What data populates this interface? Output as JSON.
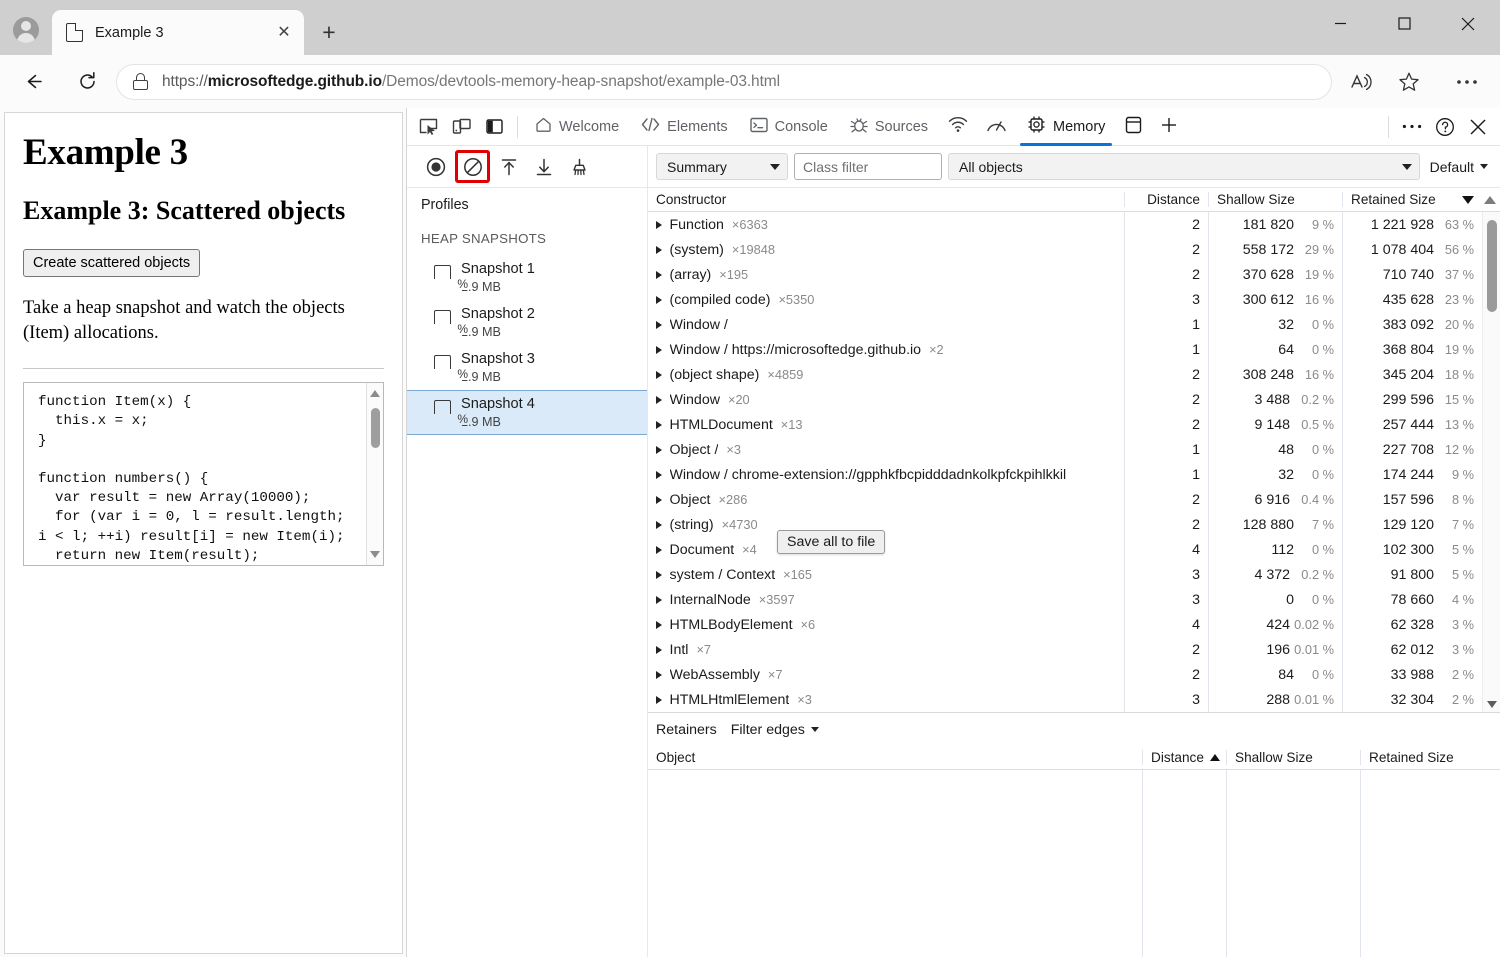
{
  "browser": {
    "tab": {
      "title": "Example 3",
      "close_label": "✕"
    },
    "new_tab_label": "+",
    "window_controls": {
      "minimize": "minimize-icon",
      "maximize": "maximize-icon",
      "close": "close-icon"
    },
    "toolbar": {
      "back_label": "back-arrow-icon",
      "reload_label": "reload-icon",
      "url_protocol": "https://",
      "url_host": "microsoftedge.github.io",
      "url_path": "/Demos/devtools-memory-heap-snapshot/example-03.html",
      "read_aloud_label": "read-aloud-icon",
      "favorite_label": "star-icon",
      "settings_label": "ellipsis-icon"
    }
  },
  "page": {
    "h1": "Example 3",
    "h2": "Example 3: Scattered objects",
    "button": "Create scattered objects",
    "paragraph": "Take a heap snapshot and watch the objects (Item) allocations.",
    "code": "function Item(x) {\n  this.x = x;\n}\n\nfunction numbers() {\n  var result = new Array(10000);\n  for (var i = 0, l = result.length;\ni < l; ++i) result[i] = new Item(i);\n  return new Item(result);"
  },
  "devtools": {
    "left_icons": [
      "inspect-icon",
      "device-toolbar-icon",
      "dock-side-icon"
    ],
    "tabs": [
      {
        "label": "Welcome",
        "icon": "home-icon",
        "active": false
      },
      {
        "label": "Elements",
        "icon": "code-brackets-icon",
        "active": false
      },
      {
        "label": "Console",
        "icon": "console-icon",
        "active": false
      },
      {
        "label": "Sources",
        "icon": "bug-icon",
        "active": false
      },
      {
        "label": "",
        "icon": "network-icon",
        "active": false
      },
      {
        "label": "",
        "icon": "performance-icon",
        "active": false
      },
      {
        "label": "Memory",
        "icon": "memory-chip-icon",
        "active": true
      },
      {
        "label": "",
        "icon": "application-icon",
        "active": false
      },
      {
        "label": "",
        "icon": "plus-icon",
        "active": false
      }
    ],
    "right_icons": [
      "ellipsis-icon",
      "help-icon",
      "close-icon"
    ],
    "accent_color": "#0a73d6",
    "highlight_color": "#e00000"
  },
  "memory": {
    "toolbar_buttons": [
      {
        "name": "record-heap-snapshot",
        "icon": "record-circle-icon",
        "highlighted": false
      },
      {
        "name": "clear-all-profiles",
        "icon": "clear-prohibited-icon",
        "highlighted": true
      },
      {
        "name": "load-profile",
        "icon": "arrow-up-to-bar-icon",
        "highlighted": false
      },
      {
        "name": "save-profile",
        "icon": "arrow-down-to-bar-icon",
        "highlighted": false
      },
      {
        "name": "collect-garbage",
        "icon": "broom-icon",
        "highlighted": false
      }
    ],
    "view_select": "Summary",
    "class_filter_placeholder": "Class filter",
    "class_filter_value": "",
    "objects_select": "All objects",
    "default_label": "Default",
    "tooltip_button": "Save all to file"
  },
  "profiles": {
    "title": "Profiles",
    "group_label": "HEAP SNAPSHOTS",
    "snapshots": [
      {
        "name": "Snapshot 1",
        "size": "1.9 MB",
        "selected": false
      },
      {
        "name": "Snapshot 2",
        "size": "1.9 MB",
        "selected": false
      },
      {
        "name": "Snapshot 3",
        "size": "1.9 MB",
        "selected": false
      },
      {
        "name": "Snapshot 4",
        "size": "1.9 MB",
        "selected": true
      }
    ]
  },
  "constructor_table": {
    "columns": [
      "Constructor",
      "Distance",
      "Shallow Size",
      "Retained Size"
    ],
    "sorted_by": "Retained Size",
    "sort_dir": "desc",
    "rows": [
      {
        "constructor": "Function",
        "count": "×6363",
        "distance": "2",
        "shallow": "181 820",
        "shallow_pct": "9 %",
        "retained": "1 221 928",
        "retained_pct": "63 %"
      },
      {
        "constructor": "(system)",
        "count": "×19848",
        "distance": "2",
        "shallow": "558 172",
        "shallow_pct": "29 %",
        "retained": "1 078 404",
        "retained_pct": "56 %"
      },
      {
        "constructor": "(array)",
        "count": "×195",
        "distance": "2",
        "shallow": "370 628",
        "shallow_pct": "19 %",
        "retained": "710 740",
        "retained_pct": "37 %"
      },
      {
        "constructor": "(compiled code)",
        "count": "×5350",
        "distance": "3",
        "shallow": "300 612",
        "shallow_pct": "16 %",
        "retained": "435 628",
        "retained_pct": "23 %"
      },
      {
        "constructor": "Window /",
        "count": "",
        "distance": "1",
        "shallow": "32",
        "shallow_pct": "0 %",
        "retained": "383 092",
        "retained_pct": "20 %"
      },
      {
        "constructor": "Window / https://microsoftedge.github.io",
        "count": "×2",
        "distance": "1",
        "shallow": "64",
        "shallow_pct": "0 %",
        "retained": "368 804",
        "retained_pct": "19 %"
      },
      {
        "constructor": "(object shape)",
        "count": "×4859",
        "distance": "2",
        "shallow": "308 248",
        "shallow_pct": "16 %",
        "retained": "345 204",
        "retained_pct": "18 %"
      },
      {
        "constructor": "Window",
        "count": "×20",
        "distance": "2",
        "shallow": "3 488",
        "shallow_pct": "0.2 %",
        "retained": "299 596",
        "retained_pct": "15 %"
      },
      {
        "constructor": "HTMLDocument",
        "count": "×13",
        "distance": "2",
        "shallow": "9 148",
        "shallow_pct": "0.5 %",
        "retained": "257 444",
        "retained_pct": "13 %"
      },
      {
        "constructor": "Object /",
        "count": "×3",
        "distance": "1",
        "shallow": "48",
        "shallow_pct": "0 %",
        "retained": "227 708",
        "retained_pct": "12 %"
      },
      {
        "constructor": "Window / chrome-extension://gpphkfbcpidddadnkolkpfckpihlkkil",
        "count": "",
        "distance": "1",
        "shallow": "32",
        "shallow_pct": "0 %",
        "retained": "174 244",
        "retained_pct": "9 %"
      },
      {
        "constructor": "Object",
        "count": "×286",
        "distance": "2",
        "shallow": "6 916",
        "shallow_pct": "0.4 %",
        "retained": "157 596",
        "retained_pct": "8 %"
      },
      {
        "constructor": "(string)",
        "count": "×4730",
        "distance": "2",
        "shallow": "128 880",
        "shallow_pct": "7 %",
        "retained": "129 120",
        "retained_pct": "7 %"
      },
      {
        "constructor": "Document",
        "count": "×4",
        "distance": "4",
        "shallow": "112",
        "shallow_pct": "0 %",
        "retained": "102 300",
        "retained_pct": "5 %"
      },
      {
        "constructor": "system / Context",
        "count": "×165",
        "distance": "3",
        "shallow": "4 372",
        "shallow_pct": "0.2 %",
        "retained": "91 800",
        "retained_pct": "5 %"
      },
      {
        "constructor": "InternalNode",
        "count": "×3597",
        "distance": "3",
        "shallow": "0",
        "shallow_pct": "0 %",
        "retained": "78 660",
        "retained_pct": "4 %"
      },
      {
        "constructor": "HTMLBodyElement",
        "count": "×6",
        "distance": "4",
        "shallow": "424",
        "shallow_pct": "0.02 %",
        "retained": "62 328",
        "retained_pct": "3 %"
      },
      {
        "constructor": "Intl",
        "count": "×7",
        "distance": "2",
        "shallow": "196",
        "shallow_pct": "0.01 %",
        "retained": "62 012",
        "retained_pct": "3 %"
      },
      {
        "constructor": "WebAssembly",
        "count": "×7",
        "distance": "2",
        "shallow": "84",
        "shallow_pct": "0 %",
        "retained": "33 988",
        "retained_pct": "2 %"
      },
      {
        "constructor": "HTMLHtmlElement",
        "count": "×3",
        "distance": "3",
        "shallow": "288",
        "shallow_pct": "0.01 %",
        "retained": "32 304",
        "retained_pct": "2 %"
      }
    ]
  },
  "retainers": {
    "title": "Retainers",
    "filter_label": "Filter edges",
    "columns": [
      "Object",
      "Distance",
      "Shallow Size",
      "Retained Size"
    ],
    "sorted_by": "Distance",
    "sort_dir": "asc",
    "rows": []
  }
}
